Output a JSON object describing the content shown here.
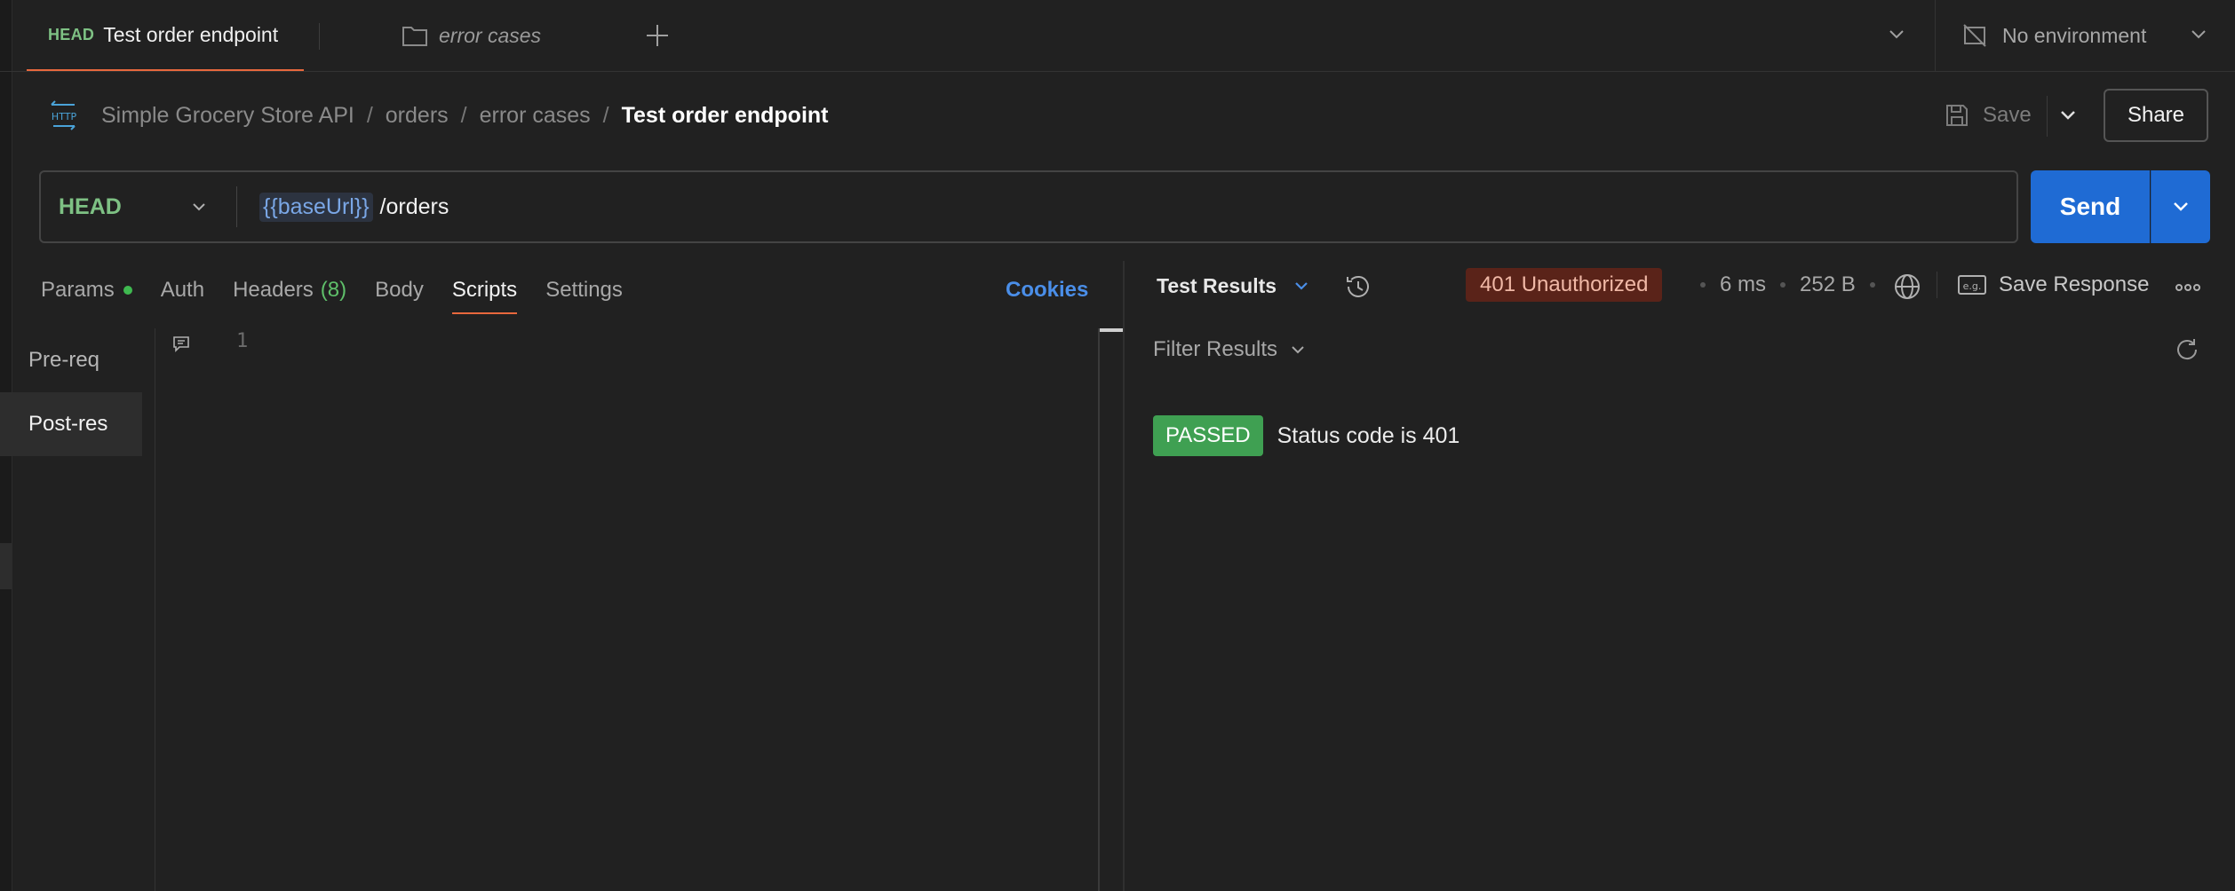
{
  "tabs": {
    "active": {
      "method": "HEAD",
      "title": "Test order endpoint"
    },
    "folder": {
      "label": "error cases"
    }
  },
  "environment": {
    "label": "No environment"
  },
  "breadcrumb": {
    "items": [
      "Simple Grocery Store API",
      "orders",
      "error cases"
    ],
    "separator": "/",
    "current": "Test order endpoint"
  },
  "toolbar": {
    "save_label": "Save",
    "share_label": "Share"
  },
  "request": {
    "method": "HEAD",
    "url_variable": "{{baseUrl}}",
    "url_path": "/orders",
    "send_label": "Send"
  },
  "request_tabs": {
    "params": "Params",
    "auth": "Auth",
    "headers": "Headers",
    "headers_count": "(8)",
    "body": "Body",
    "scripts": "Scripts",
    "settings": "Settings",
    "cookies": "Cookies"
  },
  "scripts": {
    "nav": [
      "Pre-req",
      "Post-res"
    ],
    "active_nav": "Post-res",
    "line_number": "1"
  },
  "response": {
    "tab_label": "Test Results",
    "status": "401 Unauthorized",
    "time": "6 ms",
    "size": "252 B",
    "save_response_label": "Save Response",
    "filter_label": "Filter Results",
    "results": [
      {
        "status": "PASSED",
        "name": "Status code is 401"
      }
    ]
  },
  "colors": {
    "background": "#212121",
    "accent_tab": "#e8683d",
    "method_head": "#7ec184",
    "send_button": "#1f6bd4",
    "link_blue": "#4a8ee8",
    "status_error_bg": "#5a2319",
    "passed_green": "#3fa052"
  },
  "icons": {
    "folder": "folder-icon",
    "add_tab": "plus-icon",
    "environment": "no-environment-icon",
    "http": "http-icon",
    "save": "save-icon",
    "history": "history-icon",
    "globe": "globe-icon",
    "example": "example-icon",
    "more": "more-horizontal-icon",
    "refresh": "refresh-icon",
    "comment": "comment-icon"
  }
}
